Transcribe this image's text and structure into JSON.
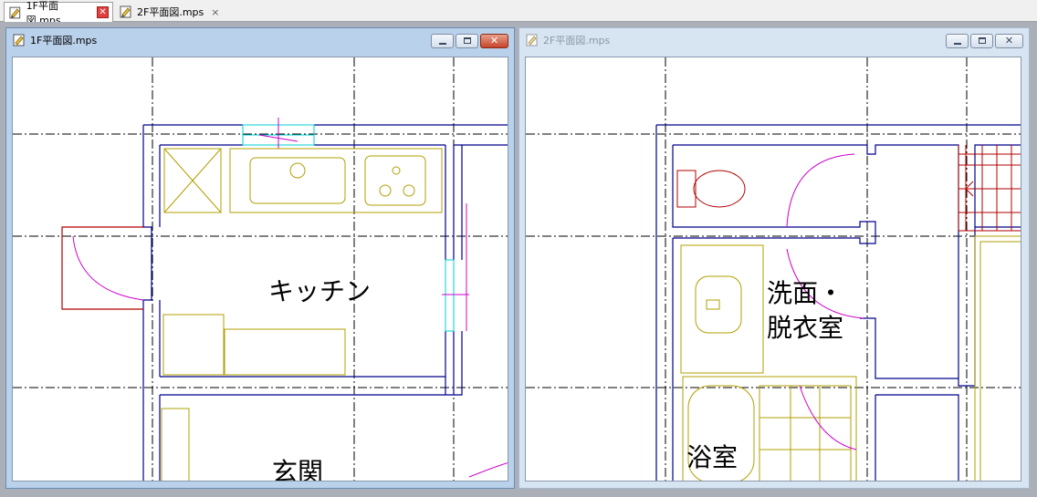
{
  "tabs": [
    {
      "label": "1F平面図.mps",
      "active": true
    },
    {
      "label": "2F平面図.mps",
      "active": false
    }
  ],
  "windows": [
    {
      "title": "1F平面図.mps",
      "rooms": {
        "kitchen": "キッチン",
        "entrance": "玄関"
      }
    },
    {
      "title": "2F平面図.mps",
      "rooms": {
        "washroom_line1": "洗面・",
        "washroom_line2": "脱衣室",
        "bathroom": "浴室"
      }
    }
  ],
  "icons": {
    "file": "drawing-file-icon",
    "minimize": "minimize-icon",
    "maximize": "maximize-icon",
    "close": "close-icon"
  },
  "colors": {
    "wall": "#00008b",
    "fixture": "#b0a000",
    "door": "#cc00cc",
    "exterior": "#b00000",
    "window_glass": "#00d0d0",
    "grid": "#000000"
  }
}
